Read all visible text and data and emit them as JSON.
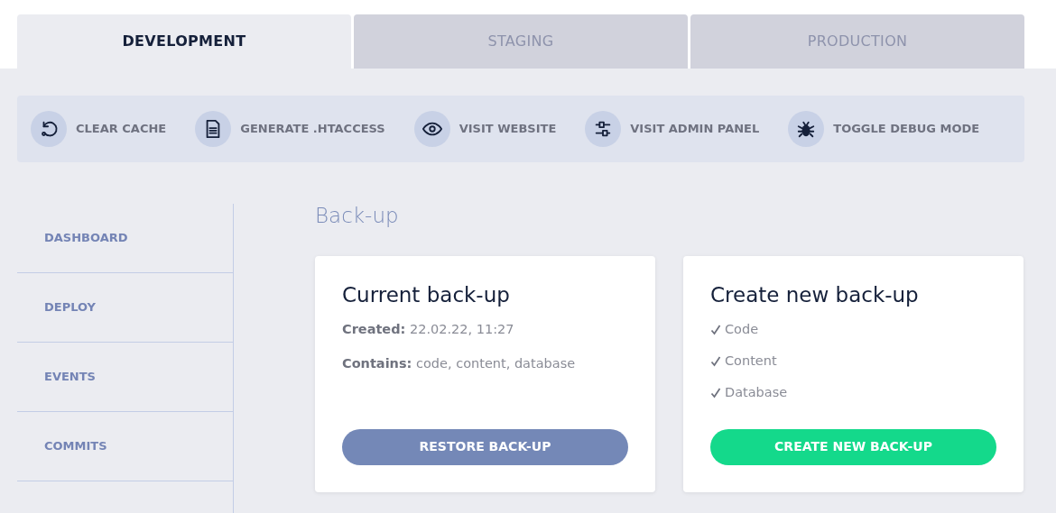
{
  "tabs": [
    {
      "label": "DEVELOPMENT",
      "selected": true
    },
    {
      "label": "STAGING",
      "selected": false
    },
    {
      "label": "PRODUCTION",
      "selected": false
    }
  ],
  "toolbar": [
    {
      "kind": "refresh",
      "label": "CLEAR CACHE"
    },
    {
      "kind": "document",
      "label": "GENERATE .HTACCESS"
    },
    {
      "kind": "eye",
      "label": "VISIT WEBSITE"
    },
    {
      "kind": "sliders",
      "label": "VISIT ADMIN PANEL"
    },
    {
      "kind": "bug",
      "label": "TOGGLE DEBUG MODE"
    }
  ],
  "sidebar": {
    "items": [
      {
        "label": "DASHBOARD"
      },
      {
        "label": "DEPLOY"
      },
      {
        "label": "EVENTS"
      },
      {
        "label": "COMMITS"
      }
    ]
  },
  "heading": "Back-up",
  "current_backup": {
    "title": "Current back-up",
    "lines": [
      "**Created:** 22.02.22, 11:27",
      "**Contains:** code, content, database"
    ],
    "button": "RESTORE BACK-UP"
  },
  "new_backup": {
    "title": "Create new back-up",
    "options": [
      {
        "label": "Code",
        "checked": true
      },
      {
        "label": "Content",
        "checked": true
      },
      {
        "label": "Database",
        "checked": true
      }
    ],
    "button": "CREATE NEW BACK-UP"
  }
}
